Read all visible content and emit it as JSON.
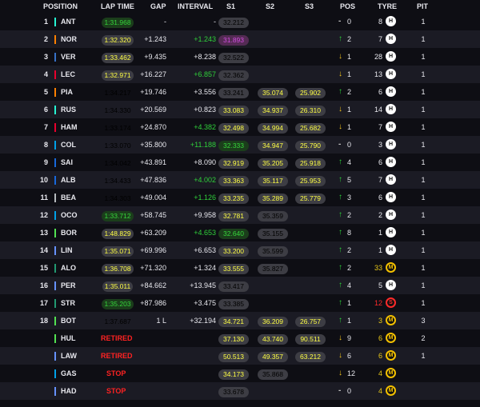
{
  "columns": {
    "position": "POSITION",
    "lap_time": "LAP TIME",
    "gap": "GAP",
    "interval": "INTERVAL",
    "s1": "S1",
    "s2": "S2",
    "s3": "S3",
    "pos": "POS",
    "tyre": "TYRE",
    "pit": "PIT"
  },
  "rows": [
    {
      "pos": "1",
      "team_color": "#27f4d2",
      "code": "ANT",
      "lap": "1:31.968",
      "lap_style": "green",
      "gap": "-",
      "interval": "-",
      "int_green": false,
      "s1": "32.212",
      "s1_style": "",
      "s2": "",
      "s2_style": "",
      "s3": "",
      "s3_style": "",
      "pc_dir": "flat",
      "pc_arrow": "-",
      "pc": "0",
      "laps": "8",
      "laps_color": "",
      "tyre": "H",
      "pit": "1"
    },
    {
      "pos": "2",
      "team_color": "#ff8000",
      "code": "NOR",
      "lap": "1:32.320",
      "lap_style": "bright",
      "gap": "+1.243",
      "interval": "+1.243",
      "int_green": true,
      "s1": "31.893",
      "s1_style": "purple",
      "s2": "",
      "s2_style": "",
      "s3": "",
      "s3_style": "",
      "pc_dir": "up",
      "pc_arrow": "↑",
      "pc": "2",
      "laps": "7",
      "laps_color": "",
      "tyre": "H",
      "pit": "1"
    },
    {
      "pos": "3",
      "team_color": "#3671c6",
      "code": "VER",
      "lap": "1:33.462",
      "lap_style": "bright",
      "gap": "+9.435",
      "interval": "+8.238",
      "int_green": false,
      "s1": "32.522",
      "s1_style": "",
      "s2": "",
      "s2_style": "",
      "s3": "",
      "s3_style": "",
      "pc_dir": "down",
      "pc_arrow": "↓",
      "pc": "1",
      "laps": "28",
      "laps_color": "",
      "tyre": "H",
      "pit": "1"
    },
    {
      "pos": "4",
      "team_color": "#e8002d",
      "code": "LEC",
      "lap": "1:32.971",
      "lap_style": "bright",
      "gap": "+16.227",
      "interval": "+6.857",
      "int_green": true,
      "s1": "32.362",
      "s1_style": "",
      "s2": "",
      "s2_style": "",
      "s3": "",
      "s3_style": "",
      "pc_dir": "down",
      "pc_arrow": "↓",
      "pc": "1",
      "laps": "13",
      "laps_color": "",
      "tyre": "H",
      "pit": "1"
    },
    {
      "pos": "5",
      "team_color": "#ff8000",
      "code": "PIA",
      "lap": "1:34.217",
      "lap_style": "",
      "gap": "+19.746",
      "interval": "+3.556",
      "int_green": false,
      "s1": "33.241",
      "s1_style": "",
      "s2": "35.074",
      "s2_style": "bright",
      "s3": "25.902",
      "s3_style": "bright",
      "pc_dir": "up",
      "pc_arrow": "↑",
      "pc": "2",
      "laps": "6",
      "laps_color": "",
      "tyre": "H",
      "pit": "1"
    },
    {
      "pos": "6",
      "team_color": "#27f4d2",
      "code": "RUS",
      "lap": "1:34.330",
      "lap_style": "",
      "gap": "+20.569",
      "interval": "+0.823",
      "int_green": false,
      "s1": "33.083",
      "s1_style": "bright",
      "s2": "34.937",
      "s2_style": "bright",
      "s3": "26.310",
      "s3_style": "bright",
      "pc_dir": "down",
      "pc_arrow": "↓",
      "pc": "1",
      "laps": "14",
      "laps_color": "",
      "tyre": "H",
      "pit": "1"
    },
    {
      "pos": "7",
      "team_color": "#e8002d",
      "code": "HAM",
      "lap": "1:33.174",
      "lap_style": "",
      "gap": "+24.870",
      "interval": "+4.382",
      "int_green": true,
      "s1": "32.498",
      "s1_style": "bright",
      "s2": "34.994",
      "s2_style": "bright",
      "s3": "25.682",
      "s3_style": "bright",
      "pc_dir": "down",
      "pc_arrow": "↓",
      "pc": "1",
      "laps": "7",
      "laps_color": "",
      "tyre": "H",
      "pit": "1"
    },
    {
      "pos": "8",
      "team_color": "#00a1e8",
      "code": "COL",
      "lap": "1:33.070",
      "lap_style": "",
      "gap": "+35.800",
      "interval": "+11.188",
      "int_green": true,
      "s1": "32.333",
      "s1_style": "green",
      "s2": "34.947",
      "s2_style": "bright",
      "s3": "25.790",
      "s3_style": "bright",
      "pc_dir": "flat",
      "pc_arrow": "-",
      "pc": "0",
      "laps": "3",
      "laps_color": "",
      "tyre": "H",
      "pit": "1"
    },
    {
      "pos": "9",
      "team_color": "#1868db",
      "code": "SAI",
      "lap": "1:34.042",
      "lap_style": "",
      "gap": "+43.891",
      "interval": "+8.090",
      "int_green": false,
      "s1": "32.919",
      "s1_style": "bright",
      "s2": "35.205",
      "s2_style": "bright",
      "s3": "25.918",
      "s3_style": "bright",
      "pc_dir": "up",
      "pc_arrow": "↑",
      "pc": "4",
      "laps": "6",
      "laps_color": "",
      "tyre": "H",
      "pit": "1"
    },
    {
      "pos": "10",
      "team_color": "#1868db",
      "code": "ALB",
      "lap": "1:34.433",
      "lap_style": "",
      "gap": "+47.836",
      "interval": "+4.002",
      "int_green": true,
      "s1": "33.363",
      "s1_style": "bright",
      "s2": "35.117",
      "s2_style": "bright",
      "s3": "25.953",
      "s3_style": "bright",
      "pc_dir": "up",
      "pc_arrow": "↑",
      "pc": "5",
      "laps": "7",
      "laps_color": "",
      "tyre": "H",
      "pit": "1"
    },
    {
      "pos": "11",
      "team_color": "#b6babd",
      "code": "BEA",
      "lap": "1:34.303",
      "lap_style": "",
      "gap": "+49.004",
      "interval": "+1.126",
      "int_green": true,
      "s1": "33.235",
      "s1_style": "bright",
      "s2": "35.289",
      "s2_style": "bright",
      "s3": "25.779",
      "s3_style": "bright",
      "pc_dir": "up",
      "pc_arrow": "↑",
      "pc": "3",
      "laps": "6",
      "laps_color": "",
      "tyre": "H",
      "pit": "1"
    },
    {
      "pos": "12",
      "team_color": "#00a1e8",
      "code": "OCO",
      "lap": "1:33.712",
      "lap_style": "green",
      "gap": "+58.745",
      "interval": "+9.958",
      "int_green": false,
      "s1": "32.781",
      "s1_style": "bright",
      "s2": "35.359",
      "s2_style": "",
      "s3": "",
      "s3_style": "",
      "pc_dir": "up",
      "pc_arrow": "↑",
      "pc": "2",
      "laps": "2",
      "laps_color": "",
      "tyre": "H",
      "pit": "1"
    },
    {
      "pos": "13",
      "team_color": "#52e252",
      "code": "BOR",
      "lap": "1:48.829",
      "lap_style": "bright",
      "gap": "+63.209",
      "interval": "+4.653",
      "int_green": true,
      "s1": "32.640",
      "s1_style": "green",
      "s2": "35.155",
      "s2_style": "",
      "s3": "",
      "s3_style": "",
      "pc_dir": "up",
      "pc_arrow": "↑",
      "pc": "8",
      "laps": "1",
      "laps_color": "",
      "tyre": "H",
      "pit": "1"
    },
    {
      "pos": "14",
      "team_color": "#6692ff",
      "code": "LIN",
      "lap": "1:35.071",
      "lap_style": "bright",
      "gap": "+69.996",
      "interval": "+6.653",
      "int_green": false,
      "s1": "33.200",
      "s1_style": "bright",
      "s2": "35.599",
      "s2_style": "",
      "s3": "",
      "s3_style": "",
      "pc_dir": "up",
      "pc_arrow": "↑",
      "pc": "2",
      "laps": "1",
      "laps_color": "",
      "tyre": "H",
      "pit": "1"
    },
    {
      "pos": "15",
      "team_color": "#229971",
      "code": "ALO",
      "lap": "1:36.708",
      "lap_style": "bright",
      "gap": "+71.320",
      "interval": "+1.324",
      "int_green": false,
      "s1": "33.555",
      "s1_style": "bright",
      "s2": "35.827",
      "s2_style": "",
      "s3": "",
      "s3_style": "",
      "pc_dir": "up",
      "pc_arrow": "↑",
      "pc": "2",
      "laps": "33",
      "laps_color": "y",
      "tyre": "M",
      "pit": "1"
    },
    {
      "pos": "16",
      "team_color": "#6692ff",
      "code": "PER",
      "lap": "1:35.011",
      "lap_style": "bright",
      "gap": "+84.662",
      "interval": "+13.945",
      "int_green": false,
      "s1": "33.417",
      "s1_style": "",
      "s2": "",
      "s2_style": "",
      "s3": "",
      "s3_style": "",
      "pc_dir": "up",
      "pc_arrow": "↑",
      "pc": "4",
      "laps": "5",
      "laps_color": "",
      "tyre": "H",
      "pit": "1"
    },
    {
      "pos": "17",
      "team_color": "#229971",
      "code": "STR",
      "lap": "1:35.203",
      "lap_style": "green",
      "gap": "+87.986",
      "interval": "+3.475",
      "int_green": false,
      "s1": "33.385",
      "s1_style": "",
      "s2": "",
      "s2_style": "",
      "s3": "",
      "s3_style": "",
      "pc_dir": "up",
      "pc_arrow": "↑",
      "pc": "1",
      "laps": "12",
      "laps_color": "r",
      "tyre": "S",
      "pit": "1"
    },
    {
      "pos": "18",
      "team_color": "#52e252",
      "code": "BOT",
      "lap": "1:37.687",
      "lap_style": "",
      "gap": "1 L",
      "interval": "+32.194",
      "int_green": false,
      "s1": "34.721",
      "s1_style": "bright",
      "s2": "36.209",
      "s2_style": "bright",
      "s3": "26.757",
      "s3_style": "bright",
      "pc_dir": "up",
      "pc_arrow": "↑",
      "pc": "1",
      "laps": "3",
      "laps_color": "y",
      "tyre": "M",
      "pit": "3"
    },
    {
      "pos": "",
      "team_color": "#52e252",
      "code": "HUL",
      "status": "RETIRED",
      "s1": "37.130",
      "s1_style": "bright",
      "s2": "43.740",
      "s2_style": "bright",
      "s3": "90.511",
      "s3_style": "bright",
      "pc_dir": "down",
      "pc_arrow": "↓",
      "pc": "9",
      "laps": "6",
      "laps_color": "y",
      "tyre": "M",
      "pit": "2"
    },
    {
      "pos": "",
      "team_color": "#6692ff",
      "code": "LAW",
      "status": "RETIRED",
      "s1": "50.513",
      "s1_style": "bright",
      "s2": "49.357",
      "s2_style": "bright",
      "s3": "63.212",
      "s3_style": "bright",
      "pc_dir": "down",
      "pc_arrow": "↓",
      "pc": "6",
      "laps": "6",
      "laps_color": "y",
      "tyre": "M",
      "pit": "1"
    },
    {
      "pos": "",
      "team_color": "#00a1e8",
      "code": "GAS",
      "status": "STOP",
      "s1": "34.173",
      "s1_style": "bright",
      "s2": "35.868",
      "s2_style": "",
      "s3": "",
      "s3_style": "",
      "pc_dir": "down",
      "pc_arrow": "↓",
      "pc": "12",
      "laps": "4",
      "laps_color": "y",
      "tyre": "M",
      "pit": ""
    },
    {
      "pos": "",
      "team_color": "#6692ff",
      "code": "HAD",
      "status": "STOP",
      "s1": "33.678",
      "s1_style": "",
      "s2": "",
      "s2_style": "",
      "s3": "",
      "s3_style": "",
      "pc_dir": "flat",
      "pc_arrow": "-",
      "pc": "0",
      "laps": "4",
      "laps_color": "y",
      "tyre": "M",
      "pit": ""
    }
  ]
}
